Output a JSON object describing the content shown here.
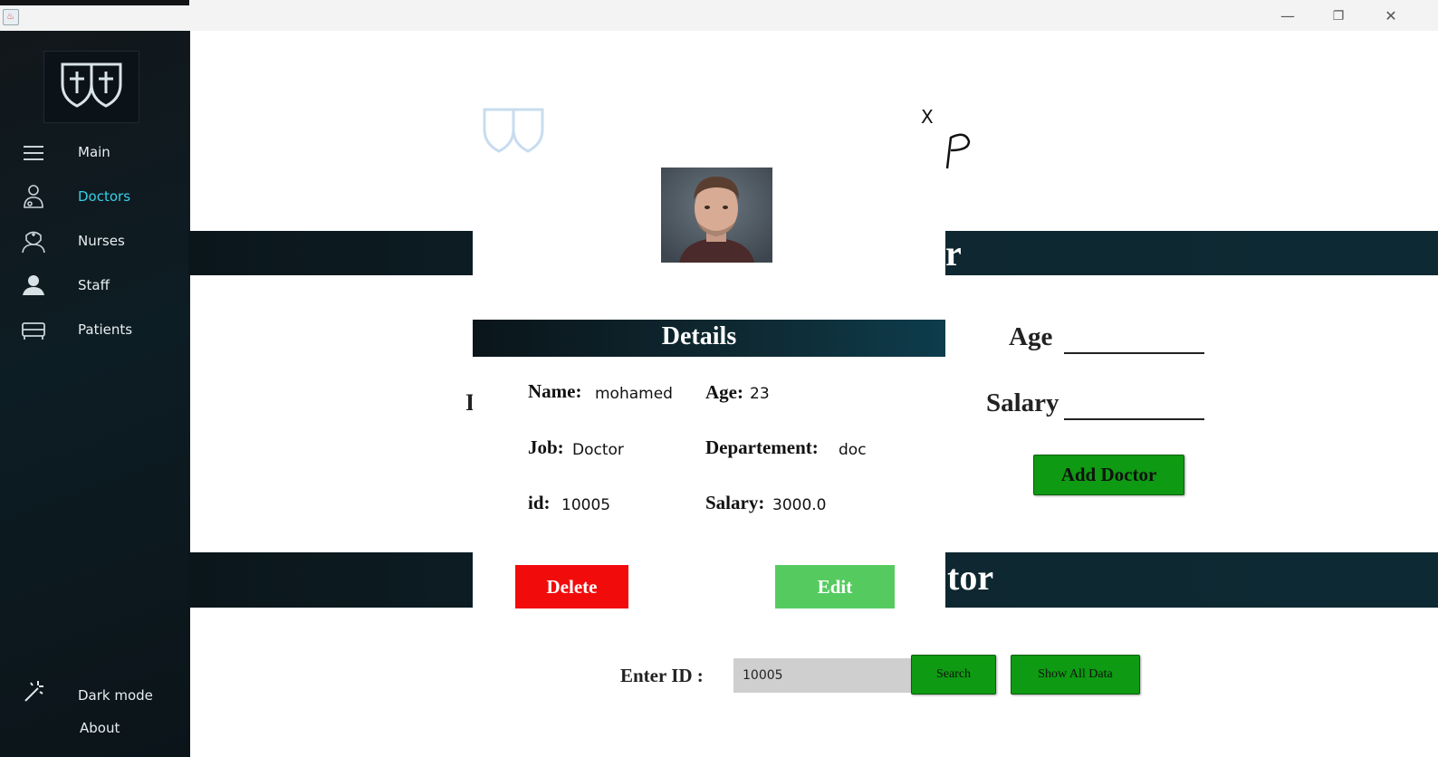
{
  "window": {
    "minimize": "—",
    "maximize": "❐",
    "close": "✕"
  },
  "sidebar": {
    "items": [
      {
        "label": "Main",
        "icon": "menu-icon",
        "active": false
      },
      {
        "label": "Doctors",
        "icon": "doctor-icon",
        "active": true
      },
      {
        "label": "Nurses",
        "icon": "nurse-icon",
        "active": false
      },
      {
        "label": "Staff",
        "icon": "staff-icon",
        "active": false
      },
      {
        "label": "Patients",
        "icon": "bed-icon",
        "active": false
      }
    ],
    "dark_mode_label": "Dark mode",
    "about_label": "About",
    "accent_color": "#35d0e5"
  },
  "background": {
    "add_section_title_fragment": "r",
    "show_section_title_fragment": "tor",
    "age_label": "Age",
    "salary_label": "Salary",
    "add_doctor_button": "Add Doctor",
    "cut_letter": "I"
  },
  "dialog": {
    "close_label": "X",
    "details_title": "Details",
    "fields": {
      "name_label": "Name:",
      "name_value": "mohamed",
      "age_label": "Age:",
      "age_value": "23",
      "job_label": "Job:",
      "job_value": "Doctor",
      "department_label": "Departement:",
      "department_value": "doc",
      "id_label": "id:",
      "id_value": "10005",
      "salary_label": "Salary:",
      "salary_value": "3000.0"
    },
    "delete_button": "Delete",
    "edit_button": "Edit",
    "colors": {
      "delete": "#f20b0b",
      "edit": "#55cb5f"
    }
  },
  "search": {
    "enter_id_label": "Enter ID :",
    "id_value": "10005",
    "search_button": "Search",
    "show_all_button": "Show All Data"
  }
}
